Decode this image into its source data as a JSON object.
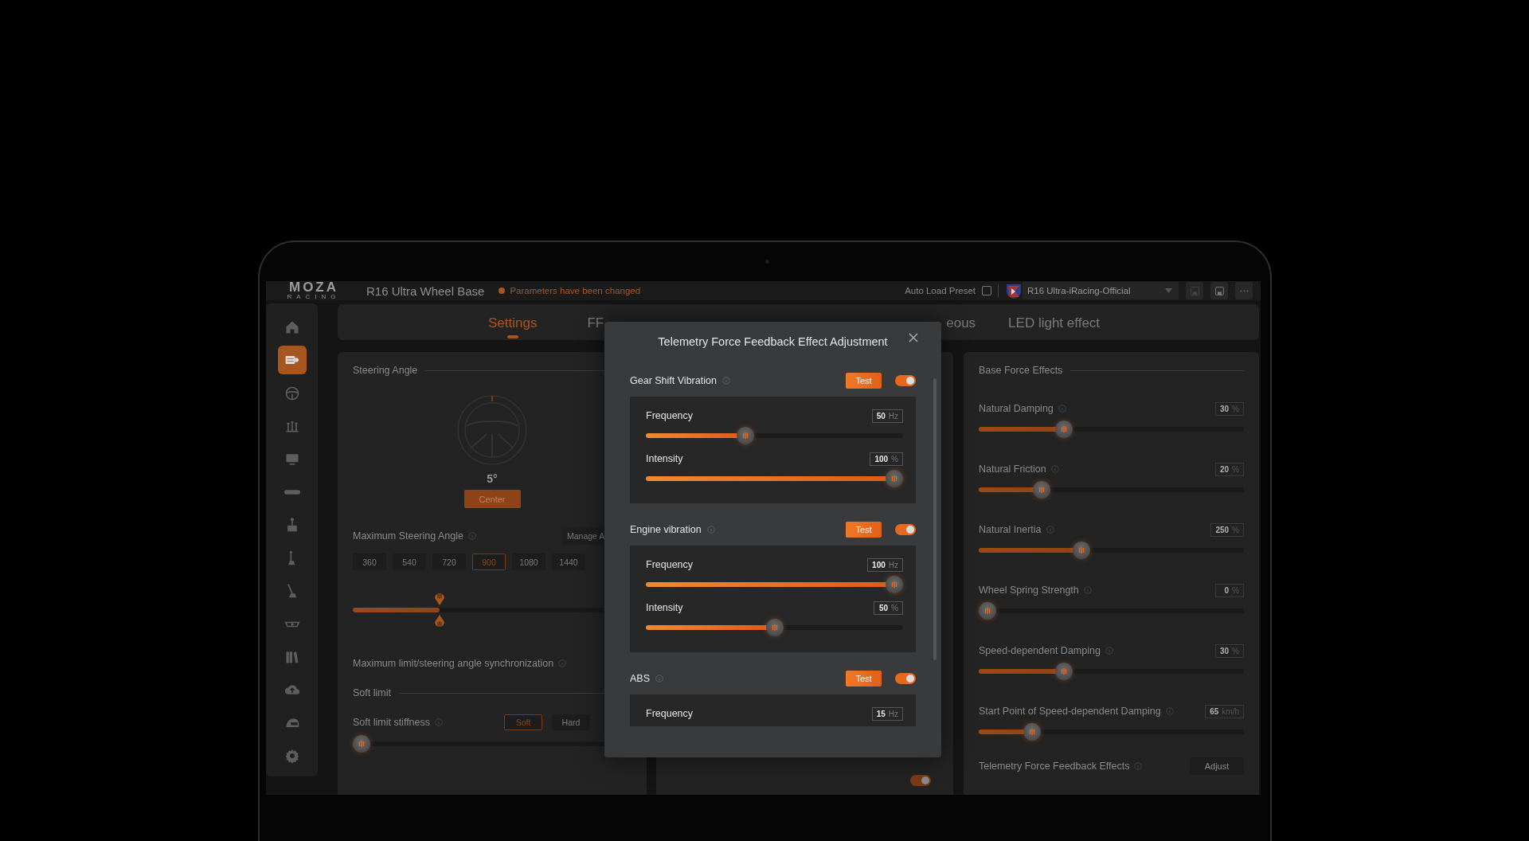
{
  "title_bar": {
    "logo": "MOZA",
    "logo_subtitle": "RACING",
    "device": "R16 Ultra Wheel Base",
    "status": "Parameters have been changed",
    "auto_load": {
      "label": "Auto Load Preset",
      "checked": false
    },
    "preset": "R16 Ultra-iRacing-Official"
  },
  "sidebar": {
    "items": [
      {
        "selected": false
      },
      {
        "selected": true
      },
      {
        "selected": false
      },
      {
        "selected": false
      },
      {
        "selected": false
      },
      {
        "selected": false
      },
      {
        "selected": false
      },
      {
        "selected": false
      },
      {
        "selected": false
      },
      {
        "selected": false
      },
      {
        "selected": false
      },
      {
        "selected": false
      },
      {
        "selected": false
      },
      {
        "selected": false
      }
    ]
  },
  "tabs": [
    {
      "label": "Settings",
      "selected": true
    },
    {
      "label": "FF",
      "selected": false
    },
    {
      "label": "eous",
      "selected": false
    },
    {
      "label": "LED light effect",
      "selected": false
    }
  ],
  "steering_panel": {
    "title": "Steering Angle",
    "angle": "5°",
    "center_button": "Center",
    "max_angle": {
      "label": "Maximum Steering Angle",
      "manage_button": "Manage A",
      "presets": [
        {
          "label": "360",
          "selected": false
        },
        {
          "label": "540",
          "selected": false
        },
        {
          "label": "720",
          "selected": false
        },
        {
          "label": "900",
          "selected": true
        },
        {
          "label": "1080",
          "selected": false
        },
        {
          "label": "1440",
          "selected": false
        }
      ],
      "level": 0.31
    },
    "sync_label": "Maximum limit/steering angle synchronization",
    "soft_limit": {
      "title": "Soft limit",
      "stiffness_label": "Soft limit stiffness",
      "options": [
        {
          "label": "Soft",
          "selected": true
        },
        {
          "label": "Hard",
          "selected": false
        }
      ],
      "level": 0
    }
  },
  "middle_panel": {
    "toggle": {
      "on": true
    }
  },
  "base_force_panel": {
    "title": "Base Force Effects",
    "effects": [
      {
        "label": "Natural Damping",
        "value": "30",
        "unit": "%",
        "level": 0.31
      },
      {
        "label": "Natural Friction",
        "value": "20",
        "unit": "%",
        "level": 0.22
      },
      {
        "label": "Natural Inertia",
        "value": "250",
        "unit": "%",
        "level": 0.38
      },
      {
        "label": "Wheel Spring Strength",
        "value": "0",
        "unit": "%",
        "level": 0
      },
      {
        "label": "Speed-dependent Damping",
        "value": "30",
        "unit": "%",
        "level": 0.31
      },
      {
        "label": "Start Point of Speed-dependent Damping",
        "value": "65",
        "unit": "km/h",
        "level": 0.18
      }
    ],
    "telemetry": {
      "label": "Telemetry Force Feedback Effects",
      "button": "Adjust"
    }
  },
  "dialog": {
    "title": "Telemetry Force Feedback Effect Adjustment",
    "effects": [
      {
        "name": "Gear Shift Vibration",
        "test_button": "Test",
        "on": true,
        "params": [
          {
            "label": "Frequency",
            "value": "50",
            "unit": "Hz",
            "level": 0.38
          },
          {
            "label": "Intensity",
            "value": "100",
            "unit": "%",
            "level": 1
          }
        ]
      },
      {
        "name": "Engine vibration",
        "test_button": "Test",
        "on": true,
        "params": [
          {
            "label": "Frequency",
            "value": "100",
            "unit": "Hz",
            "level": 1
          },
          {
            "label": "Intensity",
            "value": "50",
            "unit": "%",
            "level": 0.5
          }
        ]
      },
      {
        "name": "ABS",
        "test_button": "Test",
        "on": true,
        "params": [
          {
            "label": "Frequency",
            "value": "15",
            "unit": "Hz"
          }
        ]
      }
    ]
  }
}
